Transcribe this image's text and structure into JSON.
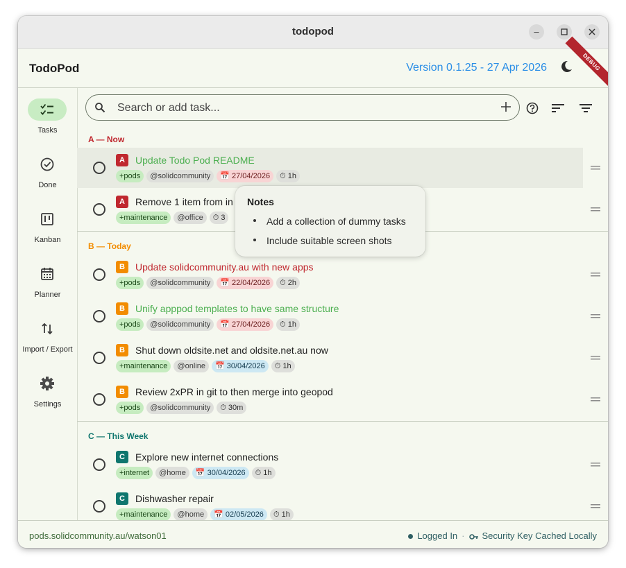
{
  "window": {
    "title": "todopod"
  },
  "appbar": {
    "title": "TodoPod",
    "version": "Version 0.1.25 - 27 Apr 2026",
    "debug": "DEBUG"
  },
  "rail": {
    "items": [
      {
        "label": "Tasks",
        "icon": "checklist-icon",
        "active": true
      },
      {
        "label": "Done",
        "icon": "check-circle-icon"
      },
      {
        "label": "Kanban",
        "icon": "kanban-icon"
      },
      {
        "label": "Planner",
        "icon": "calendar-icon"
      },
      {
        "label": "Import / Export",
        "icon": "import-export-icon"
      },
      {
        "label": "Settings",
        "icon": "gear-icon"
      }
    ]
  },
  "search": {
    "placeholder": "Search or add task..."
  },
  "sections": [
    {
      "header": "A — Now",
      "color": "#c0282f",
      "tasks": [
        {
          "priority": "A",
          "title": "Update Todo Pod README",
          "title_color": "#4caf50",
          "project": "+pods",
          "context": "@solidcommunity",
          "due": "27/04/2026",
          "due_style": "red",
          "duration": "1h"
        },
        {
          "priority": "A",
          "title": "Remove 1 item from in",
          "title_color": "#1f1f1f",
          "project": "+maintenance",
          "context": "@office",
          "due": "",
          "due_style": "",
          "duration": "3"
        }
      ]
    },
    {
      "header": "B — Today",
      "color": "#f28c00",
      "tasks": [
        {
          "priority": "B",
          "title": "Update solidcommunity.au with new apps",
          "title_color": "#c0282f",
          "project": "+pods",
          "context": "@solidcommunity",
          "due": "22/04/2026",
          "due_style": "red",
          "duration": "2h"
        },
        {
          "priority": "B",
          "title": "Unify apppod templates to have same structure",
          "title_color": "#4caf50",
          "project": "+pods",
          "context": "@solidcommunity",
          "due": "27/04/2026",
          "due_style": "red",
          "duration": "1h"
        },
        {
          "priority": "B",
          "title": "Shut down oldsite.net and oldsite.net.au now",
          "title_color": "#1f1f1f",
          "project": "+maintenance",
          "context": "@online",
          "due": "30/04/2026",
          "due_style": "blue",
          "duration": "1h"
        },
        {
          "priority": "B",
          "title": "Review 2xPR in git to then merge into geopod",
          "title_color": "#1f1f1f",
          "project": "+pods",
          "context": "@solidcommunity",
          "due": "",
          "due_style": "",
          "duration": "30m"
        }
      ]
    },
    {
      "header": "C — This Week",
      "color": "#0f766e",
      "tasks": [
        {
          "priority": "C",
          "title": "Explore new internet connections",
          "title_color": "#1f1f1f",
          "project": "+internet",
          "context": "@home",
          "due": "30/04/2026",
          "due_style": "blue",
          "duration": "1h"
        },
        {
          "priority": "C",
          "title": "Dishwasher repair",
          "title_color": "#1f1f1f",
          "project": "+maintenance",
          "context": "@home",
          "due": "02/05/2026",
          "due_style": "blue",
          "duration": "1h"
        }
      ]
    }
  ],
  "priority_colors": {
    "A": "#c0282f",
    "B": "#f28c00",
    "C": "#0f766e"
  },
  "tooltip": {
    "title": "Notes",
    "items": [
      "Add a collection of dummy tasks",
      "Include suitable screen shots"
    ]
  },
  "footer": {
    "url": "pods.solidcommunity.au/watson01",
    "login_status": "Logged In",
    "key_status": "Security Key Cached Locally"
  }
}
